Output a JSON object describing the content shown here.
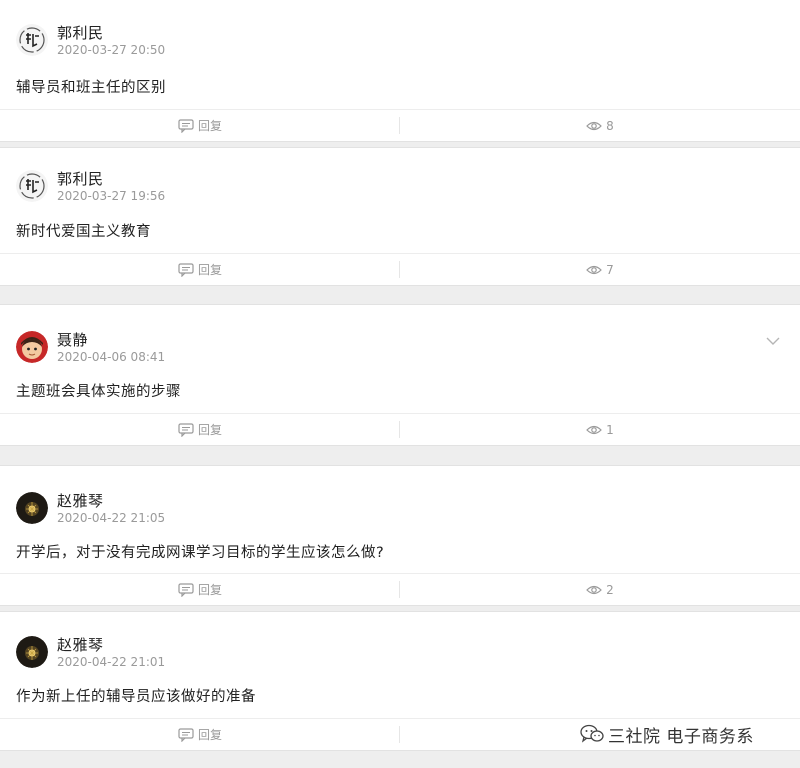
{
  "posts": [
    {
      "author": "郭利民",
      "time": "2020-03-27 20:50",
      "content": "辅导员和班主任的区别",
      "reply_label": "回复",
      "views": "8",
      "avatar": "seal-avatar"
    },
    {
      "author": "郭利民",
      "time": "2020-03-27 19:56",
      "content": "新时代爱国主义教育",
      "reply_label": "回复",
      "views": "7",
      "avatar": "seal-avatar"
    },
    {
      "author": "聂静",
      "time": "2020-04-06 08:41",
      "content": "主题班会具体实施的步骤",
      "reply_label": "回复",
      "views": "1",
      "avatar": "cartoon-face-avatar"
    },
    {
      "author": "赵雅琴",
      "time": "2020-04-22 21:05",
      "content": "开学后，对于没有完成网课学习目标的学生应该怎么做?",
      "reply_label": "回复",
      "views": "2",
      "avatar": "dark-light-avatar"
    },
    {
      "author": "赵雅琴",
      "time": "2020-04-22 21:01",
      "content": "作为新上任的辅导员应该做好的准备",
      "reply_label": "回复",
      "views": "",
      "avatar": "dark-light-avatar"
    }
  ],
  "watermark": {
    "text": "三社院 电子商务系",
    "icon": "wechat-icon"
  },
  "colors": {
    "background": "#eeeeee",
    "card": "#ffffff",
    "muted_text": "#9a9a9a"
  }
}
